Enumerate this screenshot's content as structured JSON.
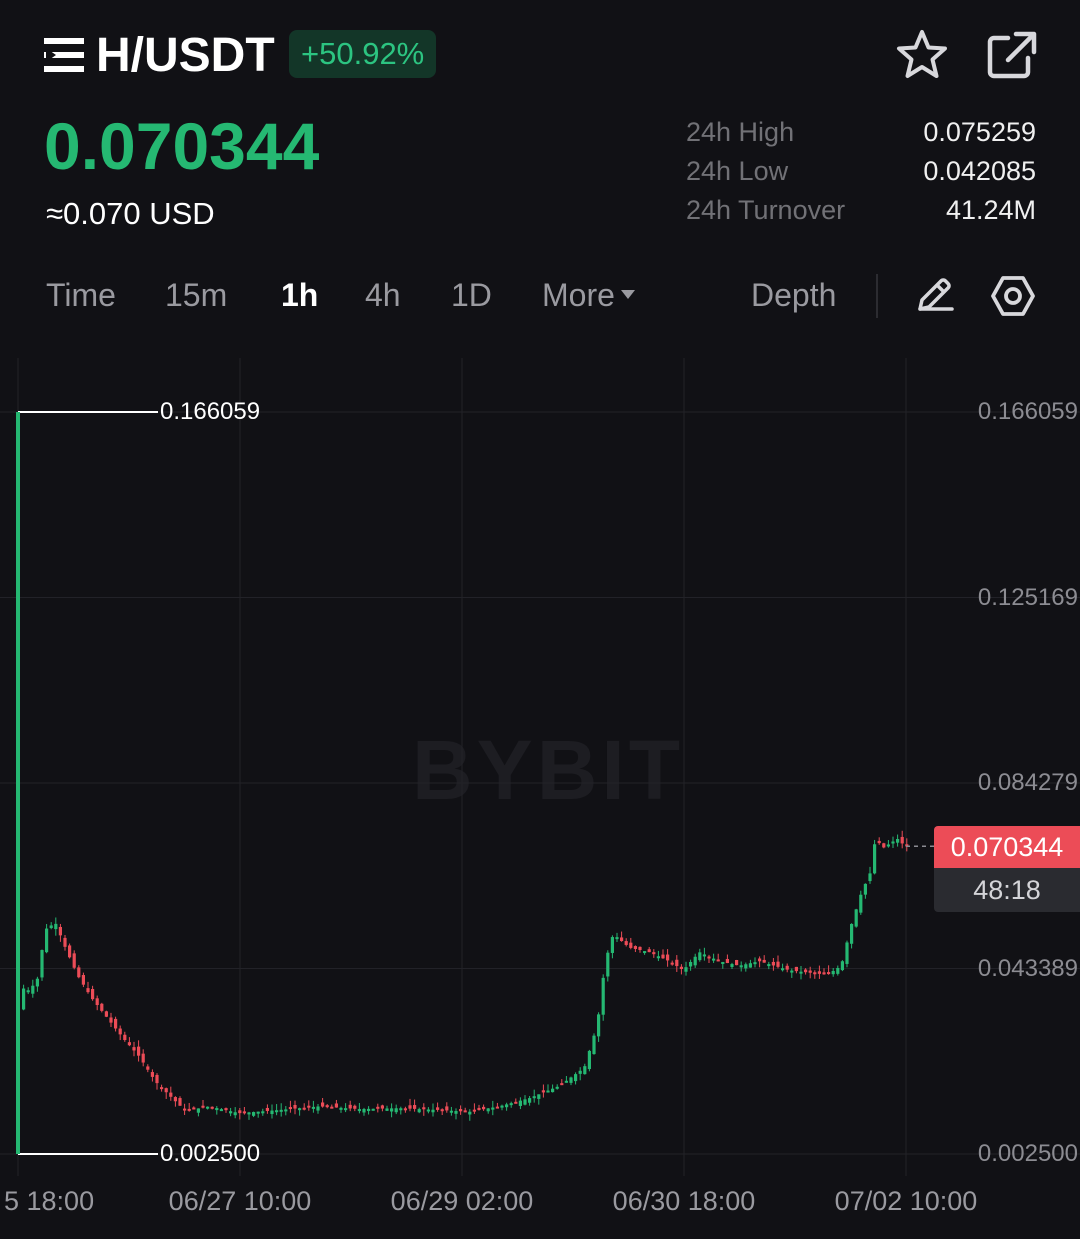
{
  "header": {
    "pair": "H/USDT",
    "change": "+50.92%",
    "price": "0.070344",
    "usd_price": "≈0.070 USD",
    "icons": [
      "menu-icon",
      "star-icon",
      "share-icon"
    ]
  },
  "stats": [
    {
      "label": "24h High",
      "value": "0.075259"
    },
    {
      "label": "24h Low",
      "value": "0.042085"
    },
    {
      "label": "24h Turnover",
      "value": "41.24M"
    }
  ],
  "timeframes": {
    "items": [
      "Time",
      "15m",
      "1h",
      "4h",
      "1D"
    ],
    "more": "More",
    "depth": "Depth",
    "active": "1h"
  },
  "watermark": "BYBIT",
  "colors": {
    "up": "#25b872",
    "down": "#ec4c57",
    "background": "#111115",
    "badge_bg": "#133628"
  },
  "chart_data": {
    "type": "candlestick",
    "y_ticks": [
      "0.166059",
      "0.125169",
      "0.084279",
      "0.043389",
      "0.002500"
    ],
    "x_ticks": [
      "5 18:00",
      "06/27 10:00",
      "06/29 02:00",
      "06/30 18:00",
      "07/02 10:00"
    ],
    "ylim": [
      0.0025,
      0.166059
    ],
    "annotations": {
      "high": "0.166059",
      "low": "0.002500"
    },
    "current_price": "0.070344",
    "countdown": "48:18",
    "grid": true
  }
}
